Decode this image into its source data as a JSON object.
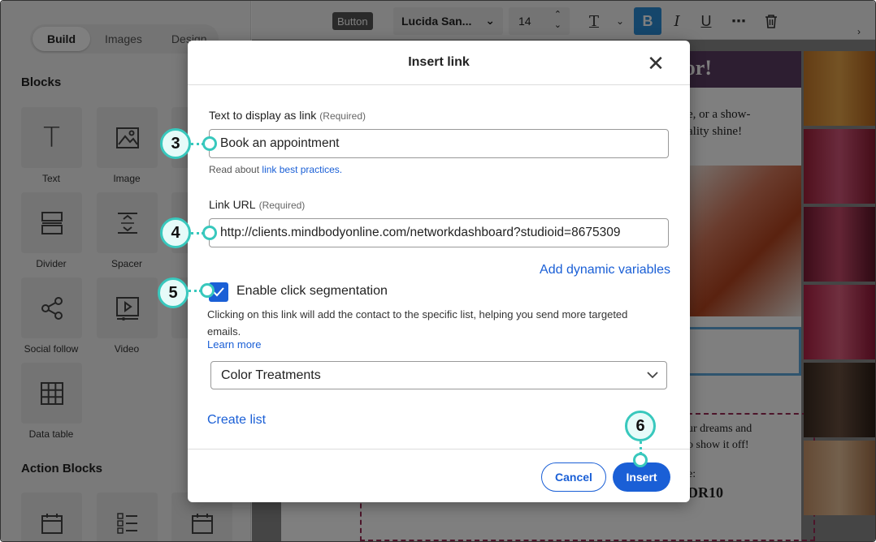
{
  "sidebar": {
    "tabs": [
      "Build",
      "Images",
      "Design"
    ],
    "blocks_title": "Blocks",
    "blocks": [
      {
        "label": "Text",
        "icon": "text-icon"
      },
      {
        "label": "Image",
        "icon": "image-icon"
      },
      {
        "label": "Divider",
        "icon": "divider-icon"
      },
      {
        "label": "Spacer",
        "icon": "spacer-icon"
      },
      {
        "label": "Social follow",
        "icon": "share-icon"
      },
      {
        "label": "Video",
        "icon": "video-icon"
      },
      {
        "label": "Data table",
        "icon": "table-icon"
      }
    ],
    "action_blocks_title": "Action Blocks"
  },
  "toolbar": {
    "chip": "Button",
    "font": "Lucida San...",
    "size": "14"
  },
  "email": {
    "banner": "or!",
    "text1": "e, or a show-",
    "text2": "ality shine!",
    "text3": "ur dreams and",
    "text4": "o show it off!",
    "text5": "e:",
    "code": "DR10"
  },
  "modal": {
    "title": "Insert link",
    "display_label": "Text to display as link",
    "required": "(Required)",
    "display_value": "Book an appointment",
    "read_about": "Read about",
    "best_practices": "link best practices.",
    "url_label": "Link URL",
    "url_value": "http://clients.mindbodyonline.com/networkdashboard?studioid=8675309",
    "dynamic_link": "Add dynamic variables",
    "segmentation_label": "Enable click segmentation",
    "segmentation_checked": true,
    "segmentation_desc": "Clicking on this link will add the contact to the specific list, helping you send more targeted emails.",
    "learn_more": "Learn more",
    "list_value": "Color Treatments",
    "create_list": "Create list",
    "cancel": "Cancel",
    "insert": "Insert"
  },
  "callouts": [
    "3",
    "4",
    "5",
    "6"
  ],
  "colors": {
    "accent": "#1a5fd6",
    "callout": "#38c8bd",
    "banner": "#5b3d63"
  }
}
